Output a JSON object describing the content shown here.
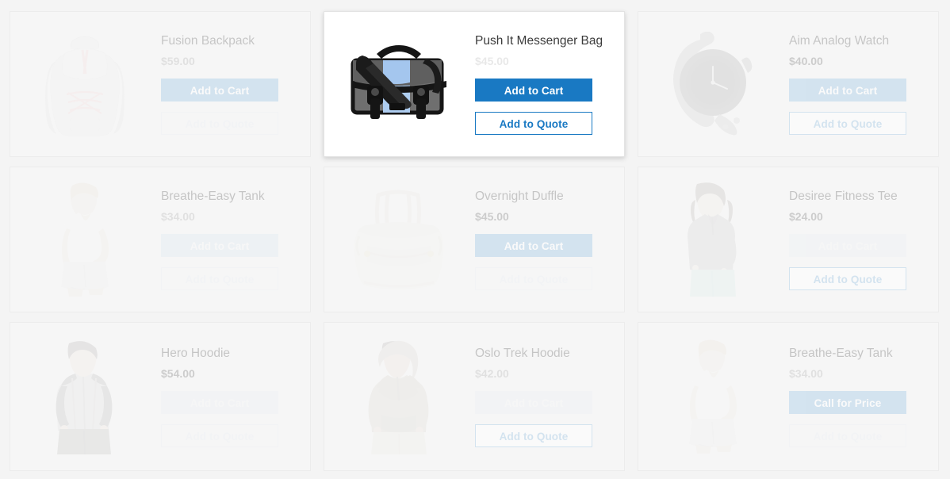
{
  "page": {
    "type": "product-grid",
    "background_color": "#f4f4f4",
    "accent_color": "#1979c3",
    "accent_faded_color": "#b4d2ea",
    "columns": 3,
    "rows": 3
  },
  "labels": {
    "add_to_cart": "Add to Cart",
    "add_to_quote": "Add to Quote",
    "call_for_price": "Call for Price"
  },
  "products": [
    {
      "name": "Fusion Backpack",
      "price": "$59.00",
      "image": "backpack-image",
      "primary_button": "Add to Cart",
      "secondary_button": "Add to Quote",
      "highlighted": false,
      "name_visibility": "mid",
      "price_visibility": "soft",
      "primary_visibility": "strong",
      "secondary_visibility": "ghost"
    },
    {
      "name": "Push It Messenger Bag",
      "price": "$45.00",
      "image": "messenger-bag-image",
      "primary_button": "Add to Cart",
      "secondary_button": "Add to Quote",
      "highlighted": true,
      "name_visibility": "full",
      "price_visibility": "soft",
      "primary_visibility": "full",
      "secondary_visibility": "full"
    },
    {
      "name": "Aim Analog Watch",
      "price": "$40.00",
      "image": "watch-image",
      "primary_button": "Add to Cart",
      "secondary_button": "Add to Quote",
      "highlighted": false,
      "name_visibility": "mid",
      "price_visibility": "mid",
      "primary_visibility": "strong",
      "secondary_visibility": "strong"
    },
    {
      "name": "Breathe-Easy Tank",
      "price": "$34.00",
      "image": "tank-woman-image",
      "primary_button": "Add to Cart",
      "secondary_button": "Add to Quote",
      "highlighted": false,
      "name_visibility": "mid",
      "price_visibility": "soft",
      "primary_visibility": "soft",
      "secondary_visibility": "ghost"
    },
    {
      "name": "Overnight Duffle",
      "price": "$45.00",
      "image": "duffle-image",
      "primary_button": "Add to Cart",
      "secondary_button": "Add to Quote",
      "highlighted": false,
      "name_visibility": "mid",
      "price_visibility": "mid",
      "primary_visibility": "strong",
      "secondary_visibility": "ghost"
    },
    {
      "name": "Desiree Fitness Tee",
      "price": "$24.00",
      "image": "fitness-tee-image",
      "primary_button": "Add to Cart",
      "secondary_button": "Add to Quote",
      "highlighted": false,
      "name_visibility": "mid",
      "price_visibility": "mid",
      "primary_visibility": "ghost",
      "secondary_visibility": "strong"
    },
    {
      "name": "Hero Hoodie",
      "price": "$54.00",
      "image": "hero-hoodie-image",
      "primary_button": "Add to Cart",
      "secondary_button": "Add to Quote",
      "highlighted": false,
      "name_visibility": "mid",
      "price_visibility": "mid",
      "primary_visibility": "ghost",
      "secondary_visibility": "ghost"
    },
    {
      "name": "Oslo Trek Hoodie",
      "price": "$42.00",
      "image": "oslo-hoodie-image",
      "primary_button": "Add to Cart",
      "secondary_button": "Add to Quote",
      "highlighted": false,
      "name_visibility": "mid",
      "price_visibility": "soft",
      "primary_visibility": "ghost",
      "secondary_visibility": "strong"
    },
    {
      "name": "Breathe-Easy Tank",
      "price": "$34.00",
      "image": "tank-woman-image",
      "primary_button": "Call for Price",
      "secondary_button": "Add to Quote",
      "highlighted": false,
      "name_visibility": "mid",
      "price_visibility": "soft",
      "primary_visibility": "strong",
      "secondary_visibility": "ghost"
    }
  ]
}
